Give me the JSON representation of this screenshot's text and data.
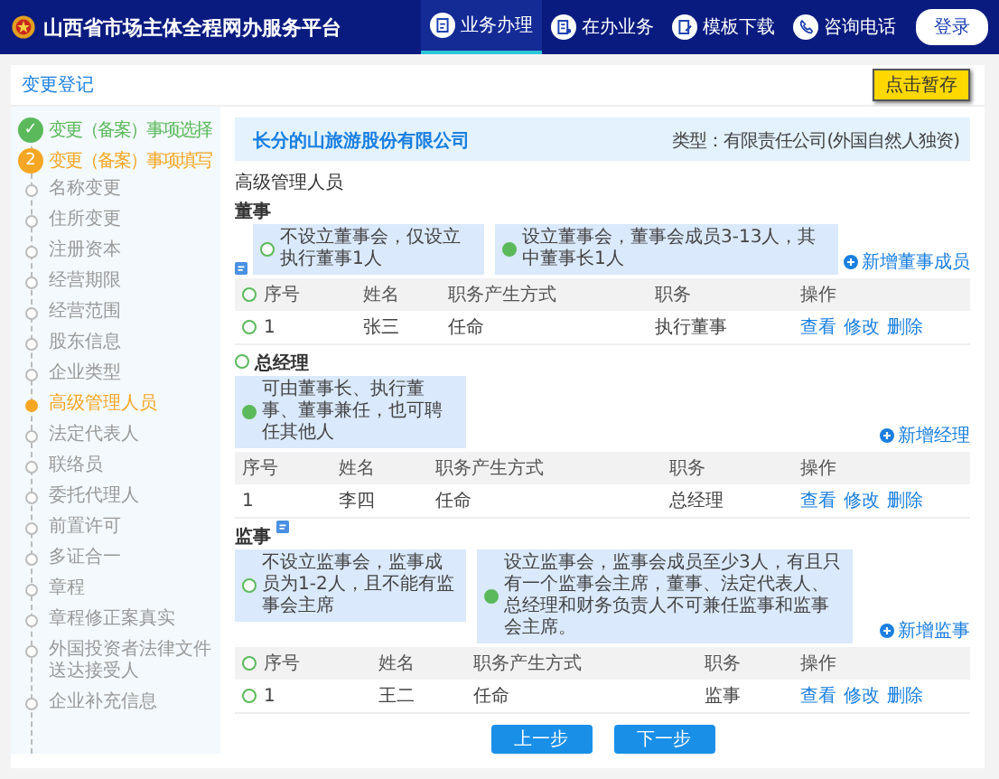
{
  "header": {
    "title": "山西省市场主体全程网办服务平台",
    "nav": [
      {
        "label": "业务办理",
        "selected": true
      },
      {
        "label": "在办业务",
        "selected": false
      },
      {
        "label": "模板下载",
        "selected": false
      },
      {
        "label": "咨询电话",
        "selected": false
      }
    ],
    "login": "登录"
  },
  "breadcrumb": "变更登记",
  "save_button": "点击暂存",
  "steps": [
    {
      "label": "变更（备案）事项选择",
      "kind": "done",
      "mark": "✓"
    },
    {
      "label": "变更（备案）事项填写",
      "kind": "current",
      "mark": "2",
      "children": [
        {
          "label": "名称变更",
          "selected": false
        },
        {
          "label": "住所变更",
          "selected": false
        },
        {
          "label": "注册资本",
          "selected": false
        },
        {
          "label": "经营期限",
          "selected": false
        },
        {
          "label": "经营范围",
          "selected": false
        },
        {
          "label": "股东信息",
          "selected": false
        },
        {
          "label": "企业类型",
          "selected": false
        },
        {
          "label": "高级管理人员",
          "selected": true
        },
        {
          "label": "法定代表人",
          "selected": false
        },
        {
          "label": "联络员",
          "selected": false
        },
        {
          "label": "委托代理人",
          "selected": false
        },
        {
          "label": "前置许可",
          "selected": false
        },
        {
          "label": "多证合一",
          "selected": false
        },
        {
          "label": "章程",
          "selected": false
        },
        {
          "label": "章程修正案真实",
          "selected": false
        },
        {
          "label": "外国投资者法律文件送达接受人",
          "selected": false
        },
        {
          "label": "企业补充信息",
          "selected": false
        }
      ]
    }
  ],
  "company": {
    "name": "长分的山旅游股份有限公司",
    "type": "类型：有限责任公司(外国自然人独资)"
  },
  "section_title": "高级管理人员",
  "groups": [
    {
      "title": "董事",
      "kind": "tag-below",
      "header_selected": false,
      "options": [
        {
          "text": "不设立董事会，仅设立执行董事1人",
          "selected": false
        },
        {
          "text": "设立董事会，董事会成员3-13人，其中董事长1人",
          "selected": true
        }
      ],
      "add": "新增董事成员",
      "selectable": true,
      "columns": [
        "序号",
        "姓名",
        "职务产生方式",
        "职务",
        "操作"
      ],
      "rows": [
        {
          "cells": [
            "1",
            "张三",
            "任命",
            "执行董事"
          ],
          "actions": [
            "查看",
            "修改",
            "删除"
          ],
          "selected": false
        }
      ]
    },
    {
      "title": "总经理",
      "kind": "radio",
      "title_selected": false,
      "options": [
        {
          "text": "可由董事长、执行董事、董事兼任，也可聘任其他人",
          "selected": true
        }
      ],
      "add": "新增经理",
      "selectable": false,
      "columns": [
        "序号",
        "姓名",
        "职务产生方式",
        "职务",
        "操作"
      ],
      "rows": [
        {
          "cells": [
            "1",
            "李四",
            "任命",
            "总经理"
          ],
          "actions": [
            "查看",
            "修改",
            "删除"
          ]
        }
      ]
    },
    {
      "title": "监事",
      "kind": "tag-corner",
      "header_selected": false,
      "options": [
        {
          "text": "不设立监事会，监事成员为1-2人，且不能有监事会主席",
          "selected": false
        },
        {
          "text": "设立监事会，监事会成员至少3人，有且只有一个监事会主席，董事、法定代表人、总经理和财务负责人不可兼任监事和监事会主席。",
          "selected": true
        }
      ],
      "add": "新增监事",
      "selectable": true,
      "columns": [
        "序号",
        "姓名",
        "职务产生方式",
        "职务",
        "操作"
      ],
      "rows": [
        {
          "cells": [
            "1",
            "王二",
            "任命",
            "监事"
          ],
          "actions": [
            "查看",
            "修改",
            "删除"
          ],
          "selected": false
        }
      ]
    }
  ],
  "footer_buttons": [
    "上一步",
    "下一步"
  ]
}
